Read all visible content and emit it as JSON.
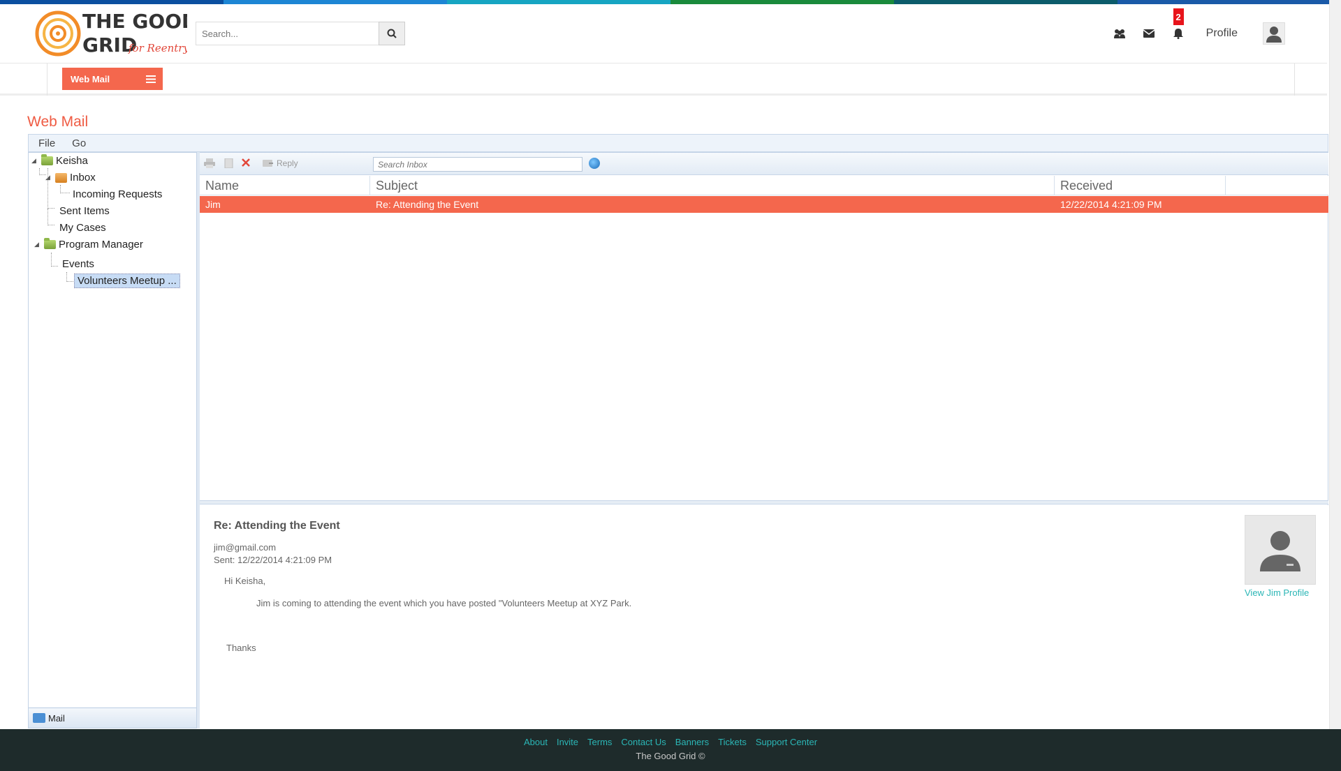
{
  "colors": {
    "accent": "#f4674d",
    "title": "#ef5b43",
    "link": "#2bb6b6",
    "footer_bg": "#1e2b2b",
    "stripe": [
      "#0b4fa0",
      "#1d86d4",
      "#17a5c2",
      "#1a8a3c",
      "#0c5c6b",
      "#1a5aa8"
    ]
  },
  "header": {
    "logo_text_1": "THE GOOD",
    "logo_text_2": "GRID",
    "logo_tagline": "for Reentry",
    "search_placeholder": "Search...",
    "search_icon": "search-icon",
    "notification_count": "2",
    "profile_label": "Profile"
  },
  "subnav": {
    "webmail_label": "Web Mail"
  },
  "page": {
    "title": "Web Mail"
  },
  "menubar": {
    "items": [
      "File",
      "Go"
    ]
  },
  "tree": {
    "root": "Keisha",
    "inbox": "Inbox",
    "incoming": "Incoming Requests",
    "sent": "Sent Items",
    "cases": "My Cases",
    "pm": "Program Manager",
    "events": "Events",
    "volunteers": "Volunteers Meetup ..."
  },
  "mail_tab": {
    "label": "Mail"
  },
  "toolbar": {
    "reply_label": "Reply",
    "search_placeholder": "Search Inbox"
  },
  "grid": {
    "columns": [
      "Name",
      "Subject",
      "Received"
    ],
    "rows": [
      {
        "name": "Jim",
        "subject": "Re: Attending the Event",
        "received": "12/22/2014 4:21:09 PM"
      }
    ]
  },
  "message": {
    "subject": "Re: Attending the Event",
    "from": "jim@gmail.com",
    "sent": "Sent: 12/22/2014 4:21:09 PM",
    "greeting": "Hi Keisha,",
    "body": "Jim is coming to attending the event which you have posted \"Volunteers Meetup at XYZ Park.",
    "thanks": "Thanks",
    "view_profile": "View Jim Profile"
  },
  "footer": {
    "links": [
      "About",
      "Invite",
      "Terms",
      "Contact Us",
      "Banners",
      "Tickets",
      "Support Center"
    ],
    "copyright": "The Good Grid ©"
  }
}
